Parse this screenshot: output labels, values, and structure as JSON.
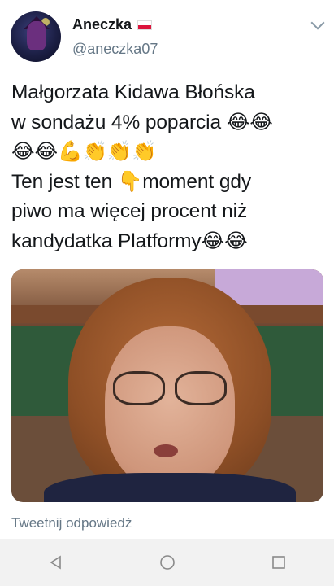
{
  "tweet": {
    "display_name": "Aneczka",
    "handle": "@aneczka07",
    "text": "Małgorzata Kidawa Błońska\nw sondażu 4% poparcia 😂😂\n😂😂💪👏👏👏\nTen jest ten 👇moment gdy\npiwo ma więcej procent niż\nkandydatka Platformy😂😂"
  },
  "reply": {
    "placeholder": "Tweetnij odpowiedź"
  },
  "icons": {
    "avatar": "avatar-image",
    "flag": "poland-flag-icon",
    "more": "chevron-down-icon",
    "nav_back": "triangle-back-icon",
    "nav_home": "circle-home-icon",
    "nav_recents": "square-recents-icon"
  },
  "colors": {
    "text": "#14171a",
    "secondary": "#657786",
    "navbar": "#f2f2f2"
  }
}
